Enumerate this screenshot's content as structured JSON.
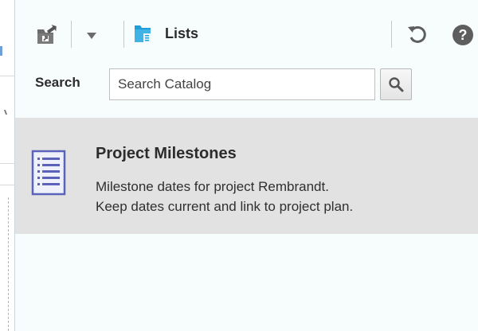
{
  "toolbar": {
    "folder_name": "Lists",
    "icons": [
      "new-folder-icon",
      "dropdown-icon",
      "lists-folder-icon",
      "refresh-icon",
      "help-icon"
    ]
  },
  "search": {
    "label": "Search",
    "placeholder": "Search Catalog",
    "value": "",
    "button_icon": "search-icon"
  },
  "results": [
    {
      "title": "Project Milestones",
      "description_line1": "Milestone dates for project Rembrandt.",
      "description_line2": "Keep dates current and link to project plan.",
      "icon": "list-document-icon"
    }
  ],
  "colors": {
    "panel_background": "#f7fcfd",
    "selected_row": "#e2e2e2",
    "folder_blue": "#1f9ed8",
    "icon_gray": "#6b6b6b"
  }
}
